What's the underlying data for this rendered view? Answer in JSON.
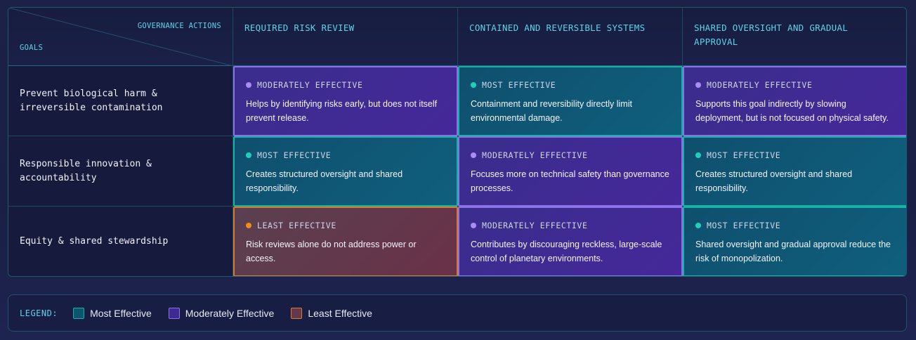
{
  "colors": {
    "most_fill": "#0f5570",
    "most_border": "#17b2a6",
    "most_dot": "#1fd0b8",
    "moderate_fill": "#3f2a92",
    "moderate_border": "#8b72e8",
    "moderate_dot": "#a98cf5",
    "least_fill": "#62384c",
    "least_border": "#d8792c",
    "least_dot": "#f28b1e"
  },
  "corner": {
    "actions_label": "GOVERNANCE ACTIONS",
    "goals_label": "GOALS"
  },
  "columns": [
    "REQUIRED RISK REVIEW",
    "CONTAINED AND REVERSIBLE SYSTEMS",
    "SHARED OVERSIGHT AND GRADUAL APPROVAL"
  ],
  "rows": [
    {
      "goal": "Prevent biological harm & irreversible contamination",
      "cells": [
        {
          "level": "moderate",
          "rating": "MODERATELY EFFECTIVE",
          "text": "Helps by identifying risks early, but does not itself prevent release."
        },
        {
          "level": "most",
          "rating": "MOST EFFECTIVE",
          "text": "Containment and reversibility directly limit environmental damage."
        },
        {
          "level": "moderate",
          "rating": "MODERATELY EFFECTIVE",
          "text": "Supports this goal indirectly by slowing deployment, but is not focused on physical safety."
        }
      ]
    },
    {
      "goal": "Responsible innovation & accountability",
      "cells": [
        {
          "level": "most",
          "rating": "MOST EFFECTIVE",
          "text": "Creates structured oversight and shared responsibility."
        },
        {
          "level": "moderate",
          "rating": "MODERATELY EFFECTIVE",
          "text": "Focuses more on technical safety than governance processes."
        },
        {
          "level": "most",
          "rating": "MOST EFFECTIVE",
          "text": "Creates structured oversight and shared responsibility."
        }
      ]
    },
    {
      "goal": "Equity & shared stewardship",
      "cells": [
        {
          "level": "least",
          "rating": "LEAST EFFECTIVE",
          "text": "Risk reviews alone do not address power or access."
        },
        {
          "level": "moderate",
          "rating": "MODERATELY EFFECTIVE",
          "text": "Contributes by discouraging reckless, large-scale control of planetary environments."
        },
        {
          "level": "most",
          "rating": "MOST EFFECTIVE",
          "text": "Shared oversight and gradual approval reduce the risk of monopolization."
        }
      ]
    }
  ],
  "legend": {
    "title": "LEGEND:",
    "items": [
      {
        "level": "most",
        "label": "Most Effective"
      },
      {
        "level": "moderate",
        "label": "Moderately Effective"
      },
      {
        "level": "least",
        "label": "Least Effective"
      }
    ]
  }
}
